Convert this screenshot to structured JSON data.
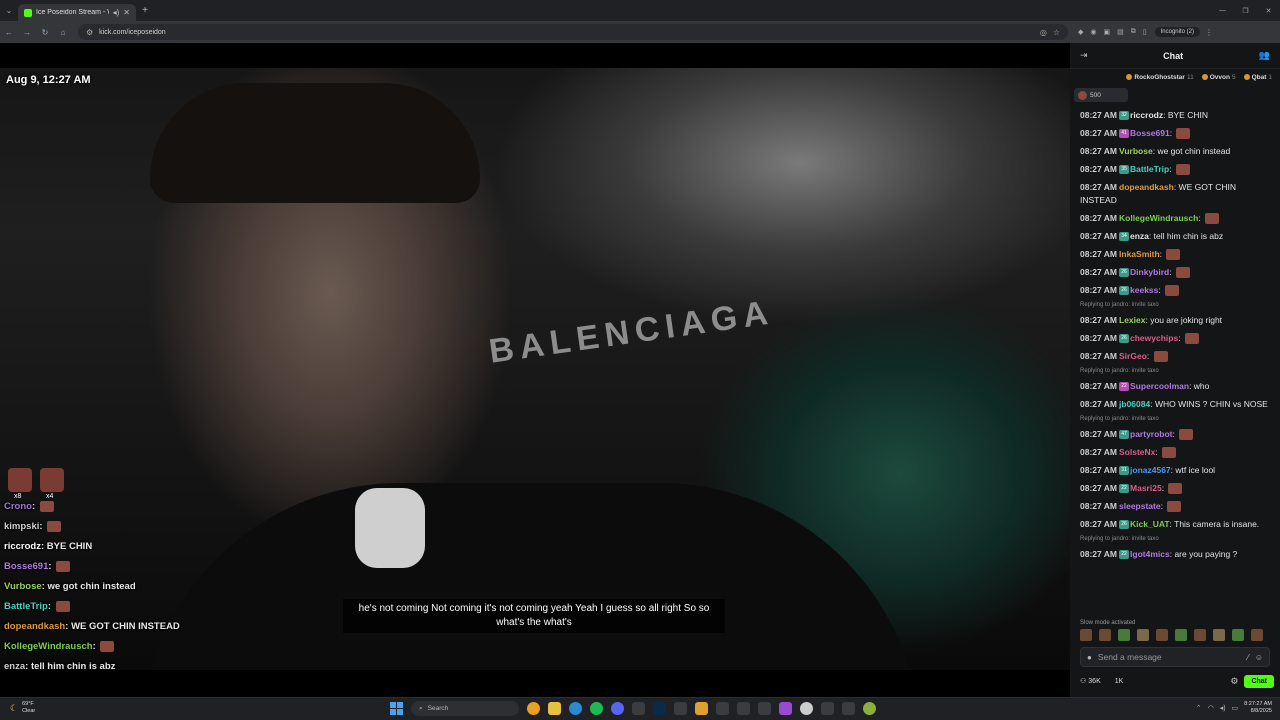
{
  "browser": {
    "tab_title": "Ice Poseidon Stream - Watc",
    "url": "kick.com/iceposeidon",
    "incognito_label": "Incognito (2)"
  },
  "video": {
    "timestamp": "Aug 9, 12:27 AM",
    "caption": "he's not coming Not coming it's not coming yeah Yeah I guess so all right So so what's the what's",
    "sign_text": "BALENCIAGA",
    "emote_counts": [
      "x8",
      "x4"
    ],
    "overlay_chat": [
      {
        "user": "Crono",
        "color": "#9a7ad0",
        "text": ""
      },
      {
        "user": "kimpski",
        "color": "#cfcfcf",
        "text": ""
      },
      {
        "user": "riccrodz",
        "color": "#ffffff",
        "text": "BYE CHIN"
      },
      {
        "user": "Bosse691",
        "color": "#b07ae0",
        "text": ""
      },
      {
        "user": "Vurbose",
        "color": "#9ad060",
        "text": "we got chin instead"
      },
      {
        "user": "BattleTrip",
        "color": "#4ad0c0",
        "text": ""
      },
      {
        "user": "dopeandkash",
        "color": "#e09a40",
        "text": "WE GOT CHIN INSTEAD"
      },
      {
        "user": "KollegeWindrausch",
        "color": "#7ad050",
        "text": ""
      },
      {
        "user": "enza",
        "color": "#cfcfcf",
        "text": "tell him chin is abz"
      }
    ]
  },
  "chat": {
    "title": "Chat",
    "leaderboard": [
      {
        "name": "RockoGhoststar",
        "count": "11"
      },
      {
        "name": "Ovvon",
        "count": "5"
      },
      {
        "name": "Qbat",
        "count": "1"
      }
    ],
    "pinned_count": "500",
    "messages": [
      {
        "time": "08:27 AM",
        "badge": "32",
        "user": "riccrodz",
        "color": "#e4e4e4",
        "text": "BYE CHIN",
        "reply": ""
      },
      {
        "time": "08:27 AM",
        "badge": "41",
        "user": "Bosse691",
        "color": "#b07ae0",
        "text": "",
        "reply": ""
      },
      {
        "time": "08:27 AM",
        "badge": "",
        "user": "Vurbose",
        "color": "#9ad060",
        "text": "we got chin instead",
        "reply": ""
      },
      {
        "time": "08:27 AM",
        "badge": "35",
        "user": "BattleTrip",
        "color": "#4ad0c0",
        "text": "",
        "reply": ""
      },
      {
        "time": "08:27 AM",
        "badge": "",
        "user": "dopeandkash",
        "color": "#e09a40",
        "text": "WE GOT CHIN INSTEAD",
        "reply": ""
      },
      {
        "time": "08:27 AM",
        "badge": "",
        "user": "KollegeWindrausch",
        "color": "#7ad050",
        "text": "",
        "reply": ""
      },
      {
        "time": "08:27 AM",
        "badge": "34",
        "user": "enza",
        "color": "#e4e4e4",
        "text": "tell him chin is abz",
        "reply": ""
      },
      {
        "time": "08:27 AM",
        "badge": "",
        "user": "InkaSmith",
        "color": "#e09a40",
        "text": "",
        "reply": ""
      },
      {
        "time": "08:27 AM",
        "badge": "26",
        "user": "Dinkybird",
        "color": "#b07ae0",
        "text": "",
        "reply": ""
      },
      {
        "time": "08:27 AM",
        "badge": "26",
        "user": "keekss",
        "color": "#b07ae0",
        "text": "",
        "reply": ""
      },
      {
        "time": "08:27 AM",
        "badge": "",
        "user": "Lexiex",
        "color": "#9ad060",
        "text": "you are joking right",
        "reply": "Replying to jandro: invite taxo"
      },
      {
        "time": "08:27 AM",
        "badge": "26",
        "user": "chewychips",
        "color": "#e05a8a",
        "text": "",
        "reply": ""
      },
      {
        "time": "08:27 AM",
        "badge": "",
        "user": "SirGeo",
        "color": "#e05a8a",
        "text": "",
        "reply": ""
      },
      {
        "time": "08:27 AM",
        "badge": "22",
        "user": "Supercoolman",
        "color": "#b07ae0",
        "text": "who",
        "reply": "Replying to jandro: invite taxo"
      },
      {
        "time": "08:27 AM",
        "badge": "",
        "user": "jb06084",
        "color": "#4ad0c0",
        "text": "WHO WINS ? CHIN vs NOSE",
        "reply": ""
      },
      {
        "time": "08:27 AM",
        "badge": "47",
        "user": "partyrobot",
        "color": "#b07ae0",
        "text": "",
        "reply": "Replying to jandro: invite taxo"
      },
      {
        "time": "08:27 AM",
        "badge": "",
        "user": "SolsteNx",
        "color": "#e05a8a",
        "text": "",
        "reply": ""
      },
      {
        "time": "08:27 AM",
        "badge": "31",
        "user": "jonaz4567",
        "color": "#4a9af0",
        "text": "wtf ice lool",
        "reply": ""
      },
      {
        "time": "08:27 AM",
        "badge": "22",
        "user": "Masri25",
        "color": "#e05a8a",
        "text": "",
        "reply": ""
      },
      {
        "time": "08:27 AM",
        "badge": "",
        "user": "sleepstate",
        "color": "#b07ae0",
        "text": "",
        "reply": ""
      },
      {
        "time": "08:27 AM",
        "badge": "26",
        "user": "Kick_UAT",
        "color": "#7ad050",
        "text": "This camera is insane.",
        "reply": ""
      },
      {
        "time": "08:27 AM",
        "badge": "22",
        "user": "Igot4mics",
        "color": "#b07ae0",
        "text": "are you paying ?",
        "reply": "Replying to jandro: invite taxo"
      }
    ],
    "slow_mode": "Slow mode activated",
    "input_placeholder": "Send a message",
    "viewers": "36K",
    "followers": "1K",
    "send_label": "Chat"
  },
  "taskbar": {
    "temp": "69°F",
    "weather": "Clear",
    "search_placeholder": "Search",
    "time": "8:27:27 AM",
    "date": "8/8/2025"
  }
}
